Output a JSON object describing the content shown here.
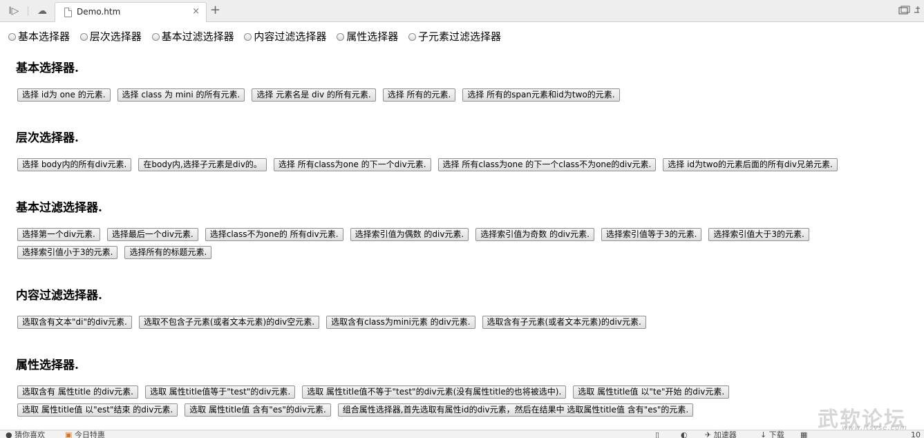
{
  "browser": {
    "tab_title": "Demo.htm",
    "close_glyph": "×",
    "newtab_glyph": "+",
    "forward_glyph": "I▷",
    "cloud_glyph": "☁"
  },
  "radio_options": [
    "基本选择器",
    "层次选择器",
    "基本过滤选择器",
    "内容过滤选择器",
    "属性选择器",
    "子元素过滤选择器"
  ],
  "sections": [
    {
      "title": "基本选择器.",
      "rows": [
        [
          "选择 id为 one 的元素.",
          "选择 class 为 mini 的所有元素.",
          "选择 元素名是 div 的所有元素.",
          "选择 所有的元素.",
          "选择 所有的span元素和id为two的元素."
        ]
      ]
    },
    {
      "title": "层次选择器.",
      "rows": [
        [
          "选择 body内的所有div元素.",
          "在body内,选择子元素是div的。",
          "选择 所有class为one 的下一个div元素.",
          "选择 所有class为one 的下一个class不为one的div元素.",
          "选择 id为two的元素后面的所有div兄弟元素."
        ]
      ]
    },
    {
      "title": "基本过滤选择器.",
      "rows": [
        [
          "选择第一个div元素.",
          "选择最后一个div元素.",
          "选择class不为one的 所有div元素.",
          "选择索引值为偶数 的div元素.",
          "选择索引值为奇数 的div元素.",
          "选择索引值等于3的元素.",
          "选择索引值大于3的元素."
        ],
        [
          "选择索引值小于3的元素.",
          "选择所有的标题元素."
        ]
      ]
    },
    {
      "title": "内容过滤选择器.",
      "rows": [
        [
          "选取含有文本\"di\"的div元素.",
          "选取不包含子元素(或者文本元素)的div空元素.",
          "选取含有class为mini元素 的div元素.",
          "选取含有子元素(或者文本元素)的div元素."
        ]
      ]
    },
    {
      "title": "属性选择器.",
      "rows": [
        [
          "选取含有 属性title 的div元素.",
          "选取 属性title值等于\"test\"的div元素.",
          "选取 属性title值不等于\"test\"的div元素(没有属性title的也将被选中).",
          "选取 属性title值 以\"te\"开始 的div元素."
        ],
        [
          "选取 属性title值 以\"est\"结束 的div元素.",
          "选取 属性title值 含有\"es\"的div元素.",
          "组合属性选择器,首先选取有属性id的div元素，然后在结果中 选取属性title值 含有\"es\"的元素."
        ]
      ]
    }
  ],
  "watermark": {
    "text": "武软论坛",
    "url": "www.ltsvse.com"
  },
  "statusbar": {
    "left_text": "猜你喜欢",
    "today_text": "今日特惠",
    "accelerator": "加速器",
    "download": "下载",
    "zoom": "10"
  }
}
